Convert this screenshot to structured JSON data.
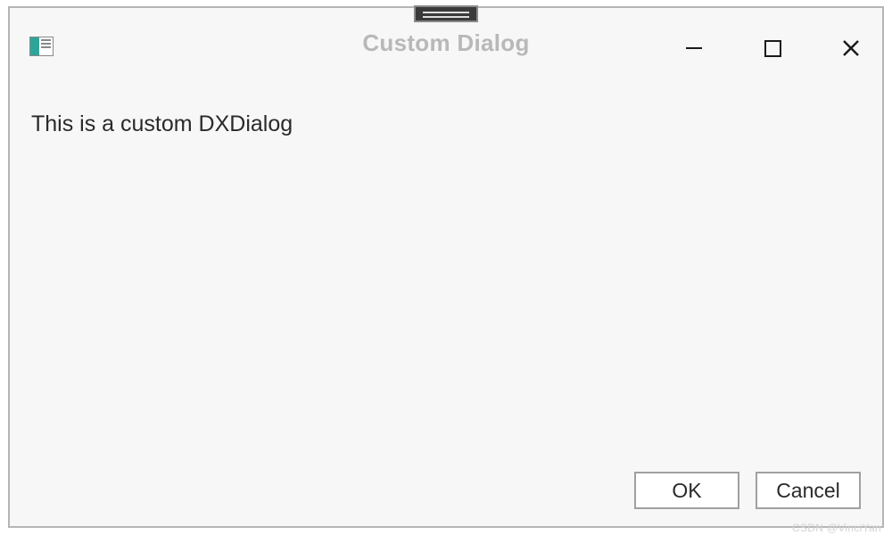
{
  "titlebar": {
    "title": "Custom Dialog"
  },
  "content": {
    "message": "This is a custom DXDialog"
  },
  "footer": {
    "ok_label": "OK",
    "cancel_label": "Cancel"
  },
  "watermark": "CSDN @VinciYan"
}
